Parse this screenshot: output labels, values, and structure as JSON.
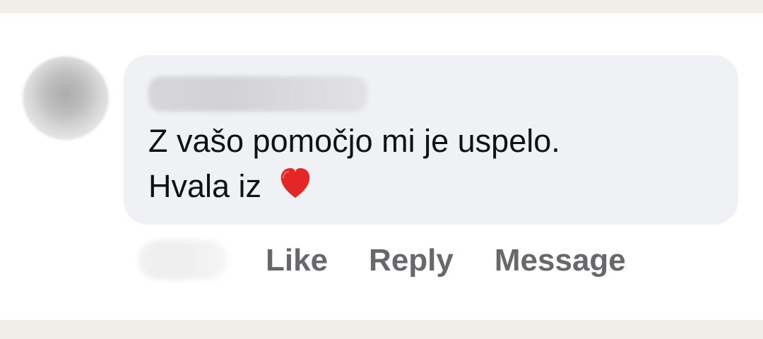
{
  "comment": {
    "text_line_1": "Z vašo pomočjo mi je uspelo.",
    "text_line_2": "Hvala iz",
    "emoji": "❤️"
  },
  "actions": {
    "like": "Like",
    "reply": "Reply",
    "message": "Message"
  },
  "icons": {
    "avatar": "avatar",
    "heart": "heart-icon"
  },
  "colors": {
    "background": "#f1eee9",
    "card": "#ffffff",
    "bubble": "#f0f1f5",
    "text": "#111111",
    "action_text": "#67686c",
    "heart": "#e32626"
  }
}
